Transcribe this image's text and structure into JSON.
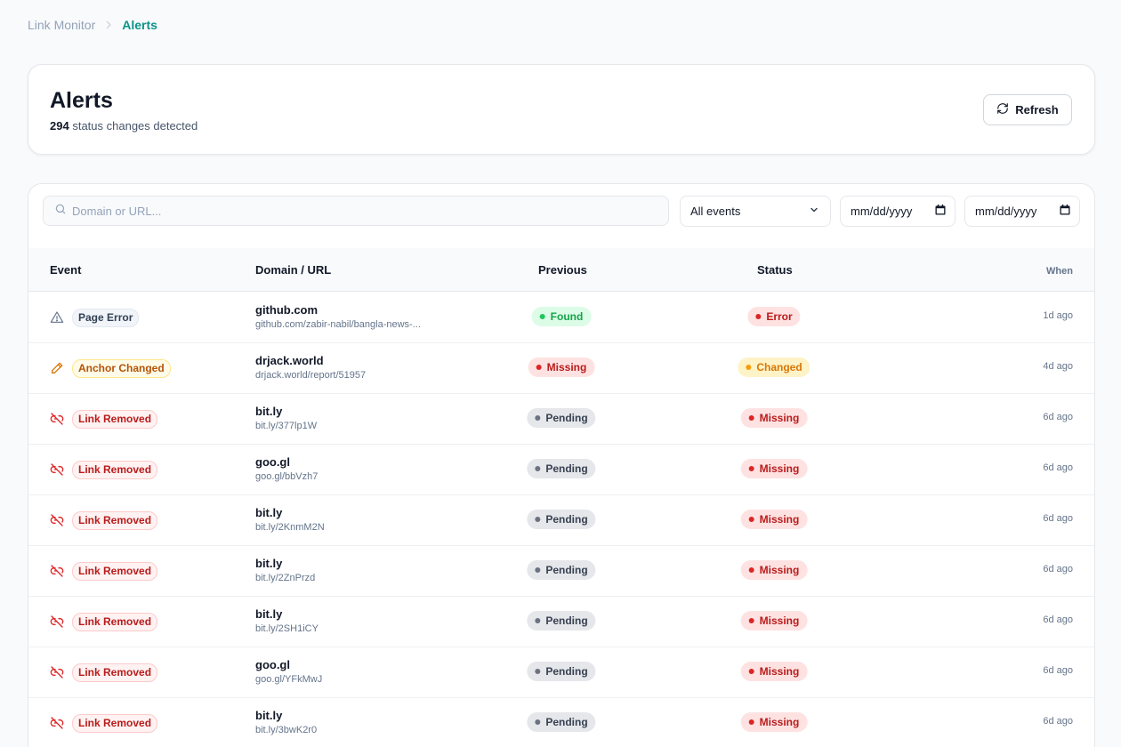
{
  "breadcrumb": {
    "root": "Link Monitor",
    "current": "Alerts"
  },
  "header": {
    "title": "Alerts",
    "count": "294",
    "subtitle_suffix": "status changes detected",
    "refresh_label": "Refresh"
  },
  "filters": {
    "search_placeholder": "Domain or URL...",
    "event_select": "All events",
    "date_from": "mm/dd/yyyy",
    "date_to": "mm/dd/yyyy"
  },
  "table": {
    "columns": {
      "event": "Event",
      "domain": "Domain / URL",
      "previous": "Previous",
      "status": "Status",
      "when": "When"
    },
    "rows": [
      {
        "event": "Page Error",
        "event_style": "gray",
        "icon": "warning-icon",
        "domain": "github.com",
        "url": "github.com/zabir-nabil/bangla-news-...",
        "previous": "Found",
        "previous_style": "green",
        "status": "Error",
        "status_style": "red",
        "when": "1d ago"
      },
      {
        "event": "Anchor Changed",
        "event_style": "amber",
        "icon": "pencil-icon",
        "domain": "drjack.world",
        "url": "drjack.world/report/51957",
        "previous": "Missing",
        "previous_style": "red",
        "status": "Changed",
        "status_style": "amber",
        "when": "4d ago"
      },
      {
        "event": "Link Removed",
        "event_style": "red",
        "icon": "unlink-icon",
        "domain": "bit.ly",
        "url": "bit.ly/377lp1W",
        "previous": "Pending",
        "previous_style": "gray",
        "status": "Missing",
        "status_style": "red",
        "when": "6d ago"
      },
      {
        "event": "Link Removed",
        "event_style": "red",
        "icon": "unlink-icon",
        "domain": "goo.gl",
        "url": "goo.gl/bbVzh7",
        "previous": "Pending",
        "previous_style": "gray",
        "status": "Missing",
        "status_style": "red",
        "when": "6d ago"
      },
      {
        "event": "Link Removed",
        "event_style": "red",
        "icon": "unlink-icon",
        "domain": "bit.ly",
        "url": "bit.ly/2KnmM2N",
        "previous": "Pending",
        "previous_style": "gray",
        "status": "Missing",
        "status_style": "red",
        "when": "6d ago"
      },
      {
        "event": "Link Removed",
        "event_style": "red",
        "icon": "unlink-icon",
        "domain": "bit.ly",
        "url": "bit.ly/2ZnPrzd",
        "previous": "Pending",
        "previous_style": "gray",
        "status": "Missing",
        "status_style": "red",
        "when": "6d ago"
      },
      {
        "event": "Link Removed",
        "event_style": "red",
        "icon": "unlink-icon",
        "domain": "bit.ly",
        "url": "bit.ly/2SH1iCY",
        "previous": "Pending",
        "previous_style": "gray",
        "status": "Missing",
        "status_style": "red",
        "when": "6d ago"
      },
      {
        "event": "Link Removed",
        "event_style": "red",
        "icon": "unlink-icon",
        "domain": "goo.gl",
        "url": "goo.gl/YFkMwJ",
        "previous": "Pending",
        "previous_style": "gray",
        "status": "Missing",
        "status_style": "red",
        "when": "6d ago"
      },
      {
        "event": "Link Removed",
        "event_style": "red",
        "icon": "unlink-icon",
        "domain": "bit.ly",
        "url": "bit.ly/3bwK2r0",
        "previous": "Pending",
        "previous_style": "gray",
        "status": "Missing",
        "status_style": "red",
        "when": "6d ago"
      }
    ]
  },
  "colors": {
    "accent": "#0d9488",
    "danger": "#b91c1c",
    "warning": "#b45309",
    "success": "#16a34a"
  }
}
